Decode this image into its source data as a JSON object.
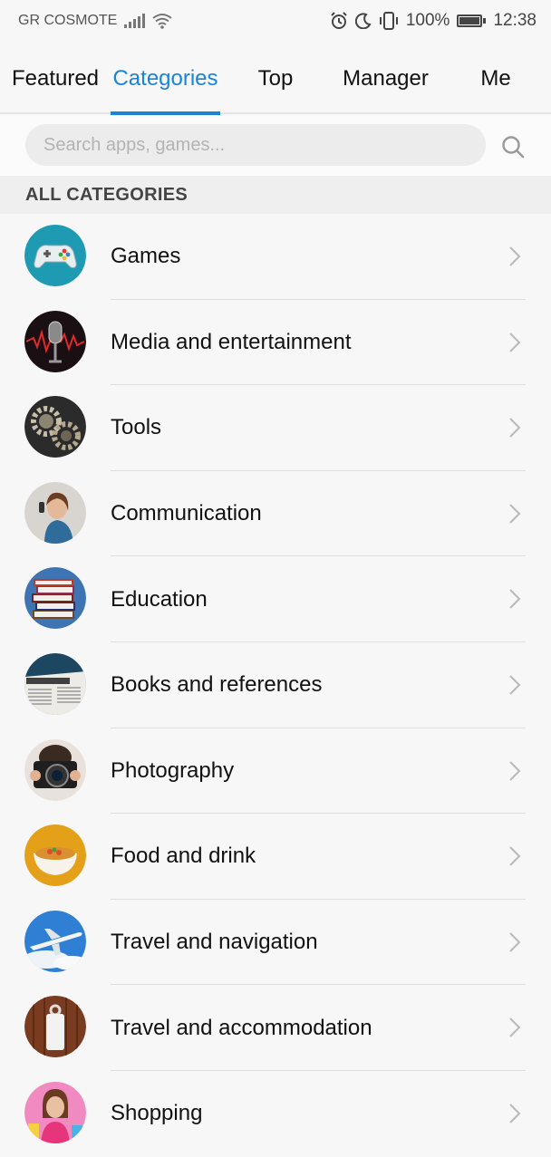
{
  "status_bar": {
    "carrier": "GR COSMOTE",
    "battery": "100%",
    "time": "12:38",
    "icons": [
      "signal-icon",
      "wifi-icon",
      "alarm-icon",
      "moon-icon",
      "vibrate-icon",
      "battery-icon"
    ]
  },
  "tabs": [
    {
      "label": "Featured",
      "active": false
    },
    {
      "label": "Categories",
      "active": true
    },
    {
      "label": "Top",
      "active": false
    },
    {
      "label": "Manager",
      "active": false
    },
    {
      "label": "Me",
      "active": false
    }
  ],
  "search": {
    "placeholder": "Search apps, games..."
  },
  "section_title": "ALL CATEGORIES",
  "categories": [
    {
      "label": "Games",
      "icon": "gamepad-icon"
    },
    {
      "label": "Media and entertainment",
      "icon": "microphone-icon"
    },
    {
      "label": "Tools",
      "icon": "gears-icon"
    },
    {
      "label": "Communication",
      "icon": "person-phone-icon"
    },
    {
      "label": "Education",
      "icon": "books-icon"
    },
    {
      "label": "Books and references",
      "icon": "newspaper-icon"
    },
    {
      "label": "Photography",
      "icon": "camera-icon"
    },
    {
      "label": "Food and drink",
      "icon": "food-bowl-icon"
    },
    {
      "label": "Travel and navigation",
      "icon": "airplane-icon"
    },
    {
      "label": "Travel and accommodation",
      "icon": "door-sign-icon"
    },
    {
      "label": "Shopping",
      "icon": "shopping-woman-icon"
    }
  ],
  "colors": {
    "accent": "#1b84d6",
    "background": "#f7f7f7",
    "divider": "#dedede"
  }
}
